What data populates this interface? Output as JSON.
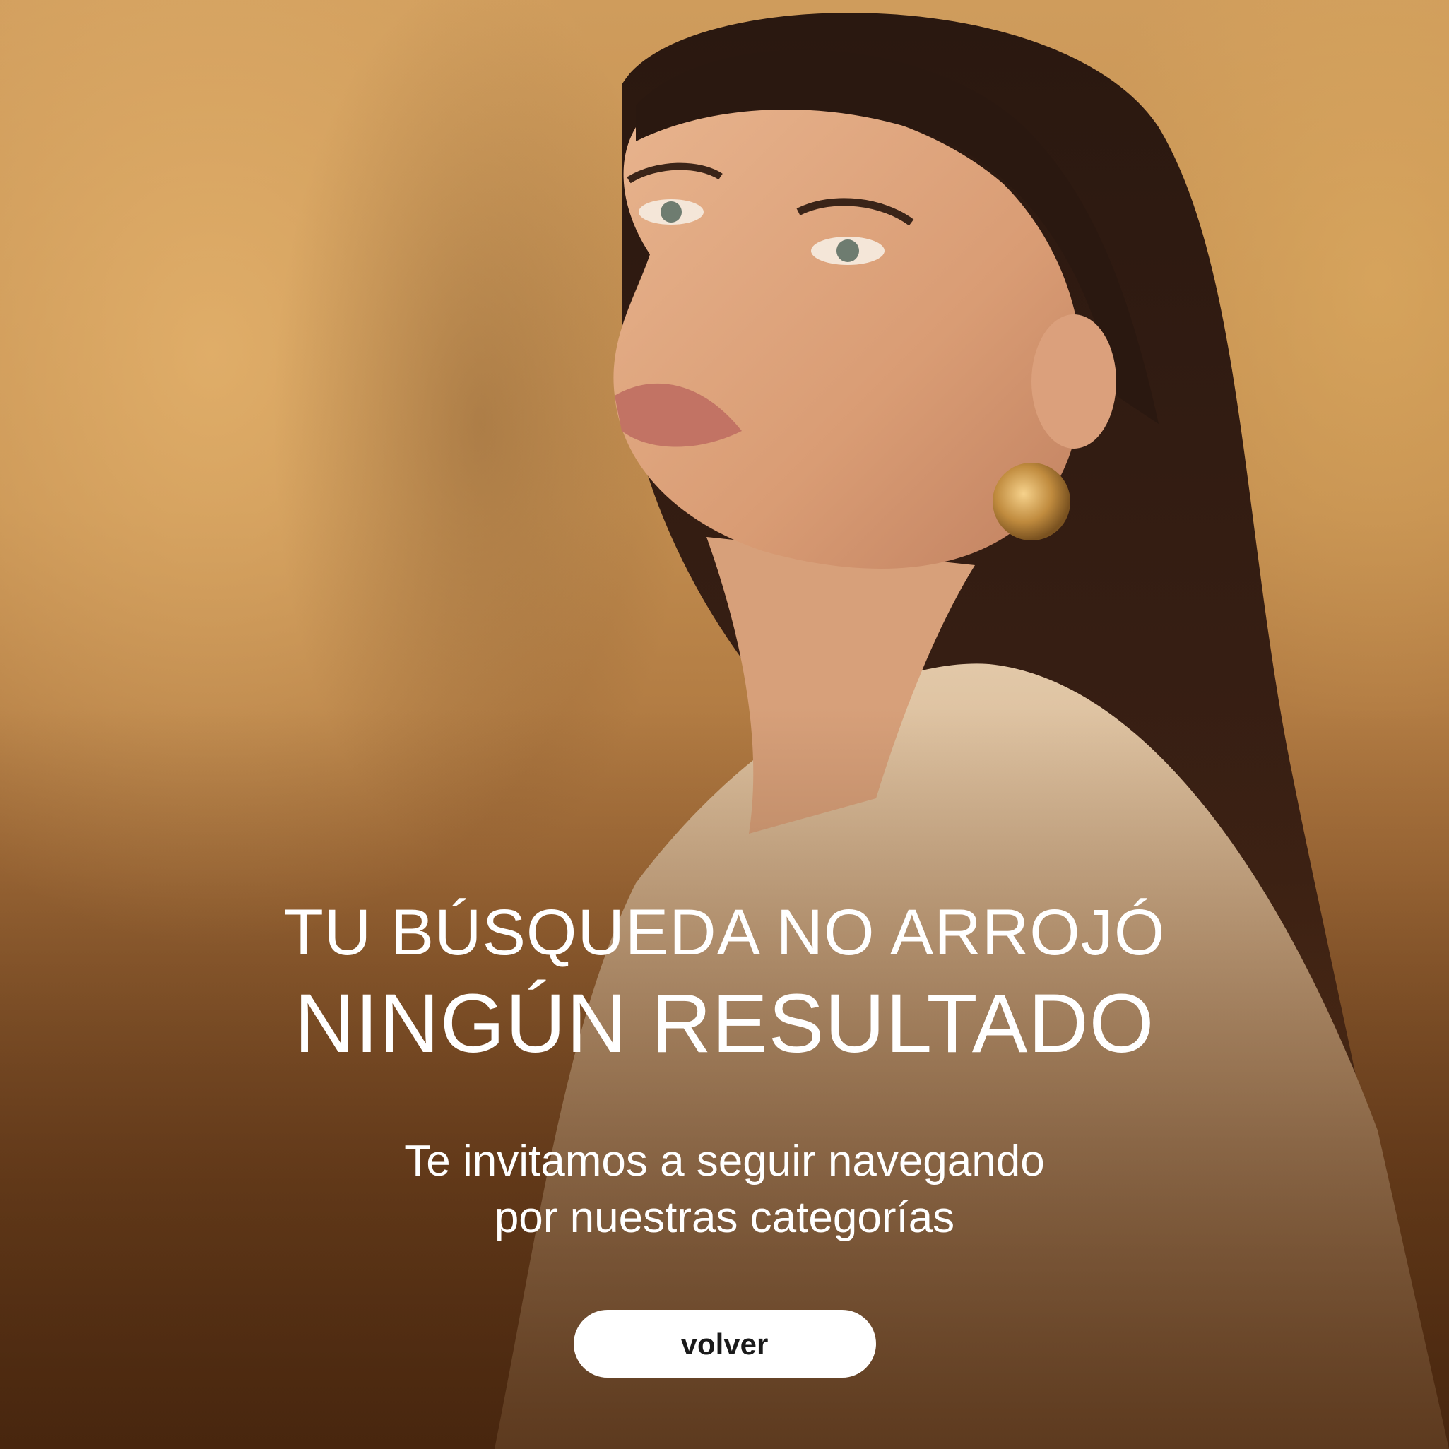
{
  "hero": {
    "headline_line1": "TU BÚSQUEDA NO ARROJÓ",
    "headline_line2": "NINGÚN RESULTADO",
    "subtext_line1": "Te invitamos a seguir navegando",
    "subtext_line2": "por nuestras categorías",
    "button_label": "volver"
  },
  "colors": {
    "text": "#ffffff",
    "button_bg": "#ffffff",
    "button_text": "#1a1a1a",
    "background_warm": "#c28d4f"
  }
}
